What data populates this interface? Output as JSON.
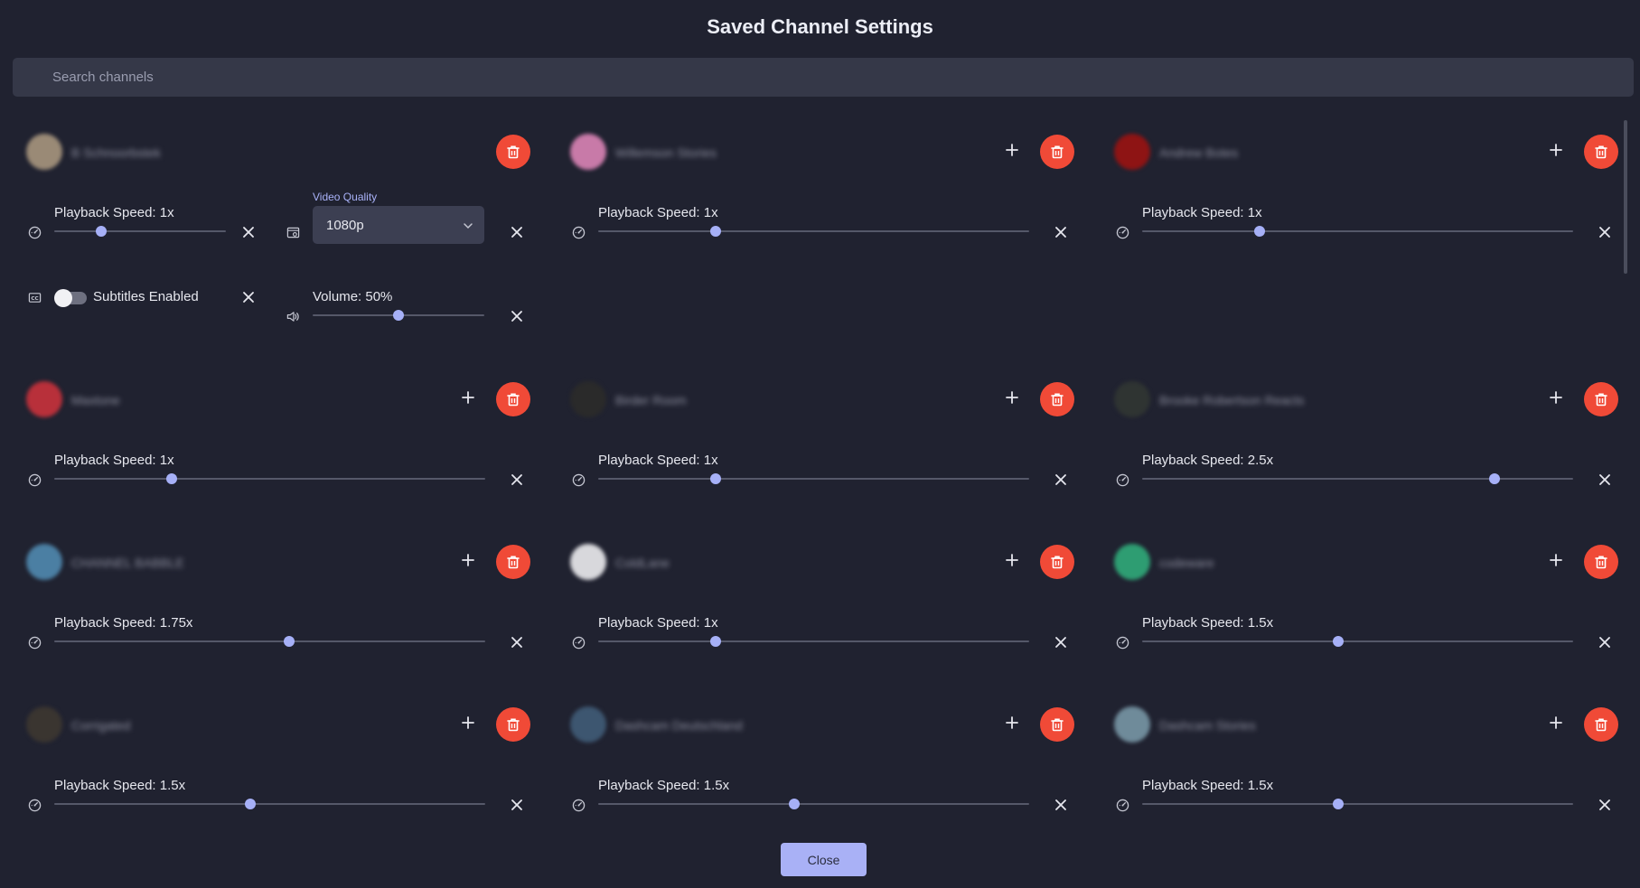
{
  "header": {
    "title": "Saved Channel Settings"
  },
  "search": {
    "placeholder": "Search channels"
  },
  "footer": {
    "close_label": "Close"
  },
  "colors": {
    "accent": "#a6b0f7",
    "delete": "#f04a37",
    "background": "#202230"
  },
  "icons": {
    "speed": "gauge-icon",
    "quality": "video-settings-icon",
    "subtitles": "closed-captions-icon",
    "volume": "volume-icon",
    "remove": "close-icon",
    "add": "plus-icon",
    "delete": "trash-icon"
  },
  "channels": [
    {
      "name": "B Schnoorbstek",
      "avatar_color": "#9a8a76",
      "speed_label": "Playback Speed: 1x",
      "speed": 1,
      "quality_caption": "Video Quality",
      "quality_value": "1080p",
      "subtitles_label": "Subtitles Enabled",
      "subtitles_on": false,
      "volume_label": "Volume: 50%",
      "volume": 50
    },
    {
      "name": "Willemson Stories",
      "avatar_color": "#c87aa8",
      "speed_label": "Playback Speed: 1x",
      "speed": 1
    },
    {
      "name": "Andrew Botes",
      "avatar_color": "#8e1414",
      "speed_label": "Playback Speed: 1x",
      "speed": 1
    },
    {
      "name": "Maxtone",
      "avatar_color": "#b8303a",
      "speed_label": "Playback Speed: 1x",
      "speed": 1
    },
    {
      "name": "Birder Room",
      "avatar_color": "#2a2a2a",
      "speed_label": "Playback Speed: 1x",
      "speed": 1
    },
    {
      "name": "Brooke Robertson Reacts",
      "avatar_color": "#2f3432",
      "speed_label": "Playback Speed: 2.5x",
      "speed": 2.5
    },
    {
      "name": "CHANNEL BABBLE",
      "avatar_color": "#4b7fa3",
      "speed_label": "Playback Speed: 1.75x",
      "speed": 1.75
    },
    {
      "name": "ColdLane",
      "avatar_color": "#d8d8dc",
      "speed_label": "Playback Speed: 1x",
      "speed": 1
    },
    {
      "name": "codeware",
      "avatar_color": "#2e9d72",
      "speed_label": "Playback Speed: 1.5x",
      "speed": 1.5
    },
    {
      "name": "Corrigated",
      "avatar_color": "#3a3530",
      "speed_label": "Playback Speed: 1.5x",
      "speed": 1.5
    },
    {
      "name": "Dashcam Deutschland",
      "avatar_color": "#3d5670",
      "speed_label": "Playback Speed: 1.5x",
      "speed": 1.5
    },
    {
      "name": "Dashcam Stories",
      "avatar_color": "#6f8b9a",
      "speed_label": "Playback Speed: 1.5x",
      "speed": 1.5
    }
  ]
}
